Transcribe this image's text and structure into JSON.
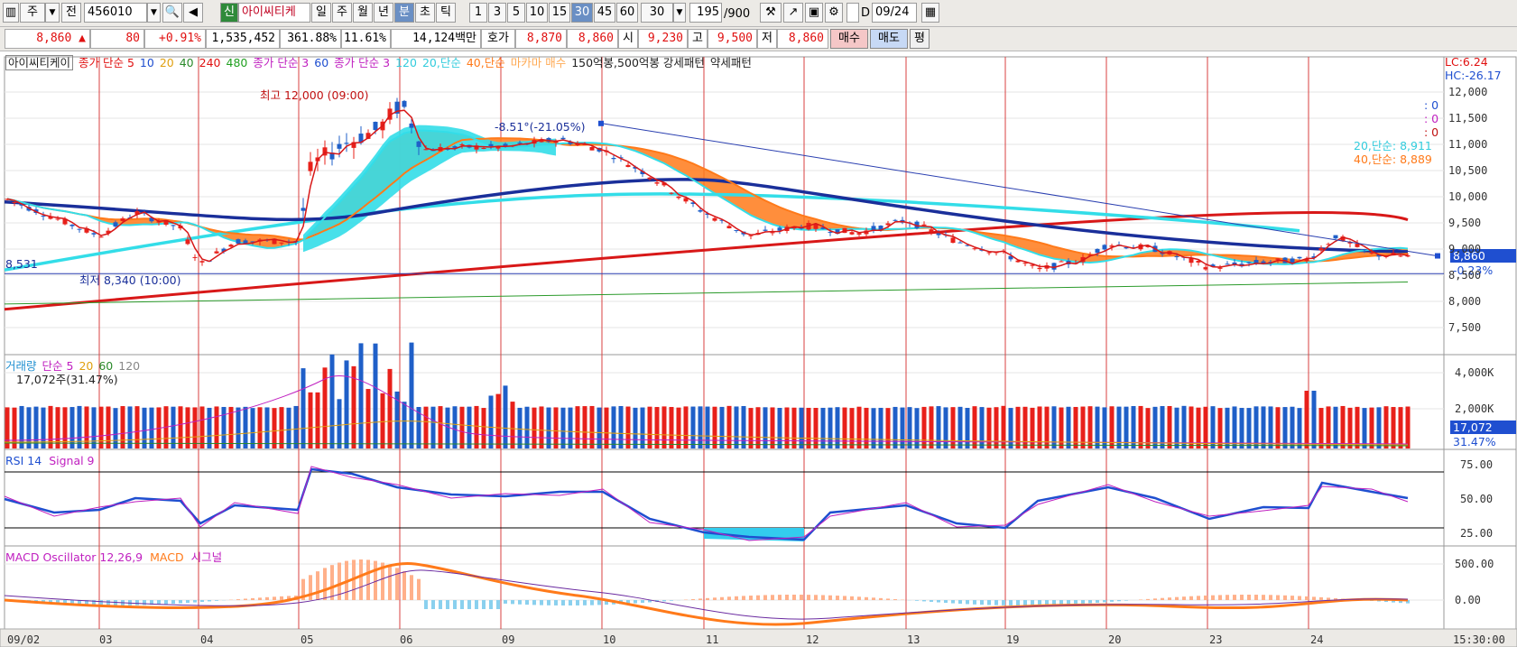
{
  "toolbar": {
    "period_btn": "주",
    "prev_btn": "전",
    "code_value": "456010",
    "badge": "신",
    "stock_name": "아이씨티케",
    "periods": [
      "일",
      "주",
      "월",
      "년",
      "분",
      "초",
      "틱"
    ],
    "active_period": "분",
    "intervals": [
      "1",
      "3",
      "5",
      "10",
      "15",
      "30",
      "45",
      "60"
    ],
    "active_interval": "30",
    "interval_select": "30",
    "count_value": "195",
    "count_total": "/900",
    "date_value": "09/24",
    "checkbox_label": "D"
  },
  "quote": {
    "price": "8,860",
    "change_arrow": "▲",
    "change": "80",
    "change_pct": "+0.91%",
    "volume": "1,535,452",
    "vol_ratio": "361.88%",
    "turnover": "11.61%",
    "amount": "14,124백만",
    "bid_label": "호가",
    "ask": "8,870",
    "bid": "8,860",
    "open_label": "시",
    "open": "9,230",
    "high_label": "고",
    "high": "9,500",
    "low_label": "저",
    "low": "8,860",
    "buy_btn": "매수",
    "sell_btn": "매도",
    "flat_btn": "평"
  },
  "price_panel": {
    "legend": [
      "아이씨티케이",
      "종가 단순 5",
      "10",
      "20",
      "40",
      "240",
      "480",
      "종가 단순 3",
      "60",
      "종가 단순 3",
      "120",
      "20,단순",
      "40,단순",
      "마카마 매수",
      "150억봉,500억봉 강세패턴",
      "약세패턴"
    ],
    "lc": "LC:6.24",
    "hc": "HC:-26.17",
    "high_note": "최고 12,000 (09:00)",
    "low_note": "최저 8,340 (10:00)",
    "trend_note": "-8.51°(-21.05%)",
    "left_level": "8,531",
    "zeros": [
      ": 0",
      ": 0",
      ": 0"
    ],
    "ma20_label": "20,단순: 8,911",
    "ma40_label": "40,단순: 8,889",
    "current_price_tag": "8,860",
    "current_pct": "-0.23%",
    "y_ticks": [
      "12,000",
      "11,500",
      "11,000",
      "10,500",
      "10,000",
      "9,500",
      "9,000",
      "8,500",
      "8,000",
      "7,500"
    ]
  },
  "volume_panel": {
    "legend": [
      "거래량",
      "단순 5",
      "20",
      "60",
      "120"
    ],
    "sub": "17,072주(31.47%)",
    "y_ticks": [
      "4,000K",
      "2,000K"
    ],
    "current_tag": "17,072",
    "current_pct": "31.47%"
  },
  "rsi_panel": {
    "legend": [
      "RSI 14",
      "Signal 9"
    ],
    "y_ticks": [
      "75.00",
      "50.00",
      "25.00"
    ]
  },
  "macd_panel": {
    "legend": [
      "MACD Oscillator 12,26,9",
      "MACD",
      "시그널"
    ],
    "y_ticks": [
      "500.00",
      "0.00"
    ]
  },
  "x_axis": {
    "labels": [
      "09/02",
      "03",
      "04",
      "05",
      "06",
      "09",
      "10",
      "11",
      "12",
      "13",
      "19",
      "20",
      "23",
      "24"
    ],
    "end_time": "15:30:00"
  },
  "colors": {
    "up": "#e8201a",
    "down": "#1f5fc8",
    "ma_red": "#d81818",
    "ma_navy": "#1a2f9a",
    "ma_cyan": "#33dde8",
    "ma_orange": "#ff7a1a",
    "day_line": "#d84040"
  }
}
